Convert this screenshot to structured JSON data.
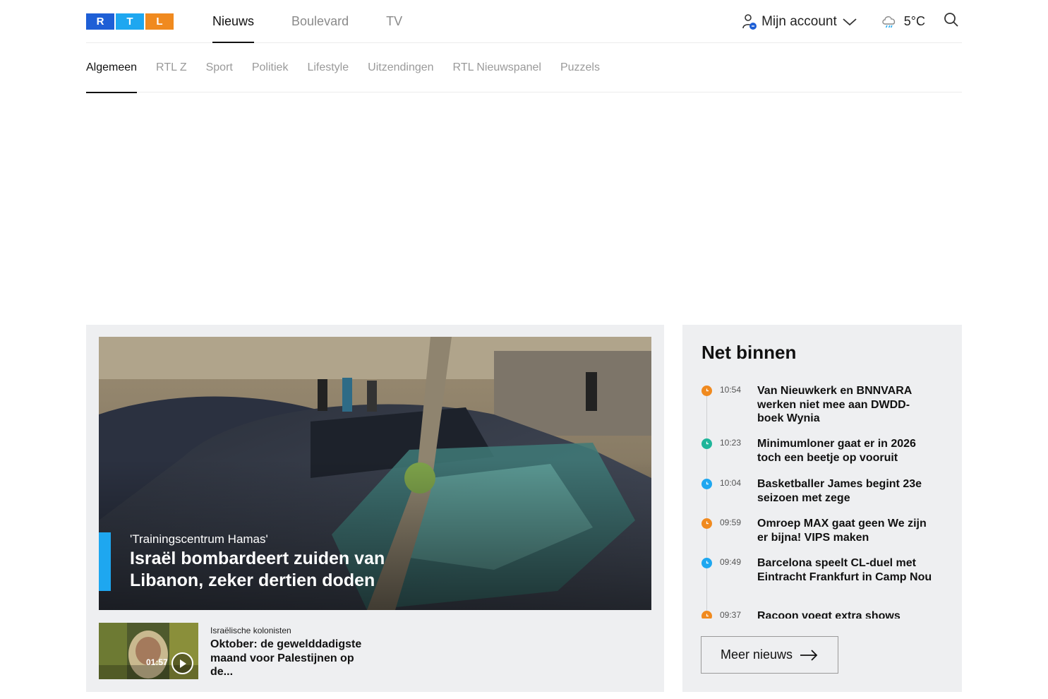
{
  "logo": {
    "letters": [
      "R",
      "T",
      "L"
    ],
    "colors": [
      "#1e5fd6",
      "#1ea7f0",
      "#f08a1f"
    ]
  },
  "main_nav": [
    {
      "label": "Nieuws",
      "active": true
    },
    {
      "label": "Boulevard",
      "active": false
    },
    {
      "label": "TV",
      "active": false
    }
  ],
  "account": {
    "label": "Mijn account",
    "icon": "user-icon"
  },
  "weather": {
    "temperature": "5°C",
    "icon": "rain-cloud-icon"
  },
  "search": {
    "icon": "search-icon"
  },
  "sub_nav": [
    {
      "label": "Algemeen",
      "active": true
    },
    {
      "label": "RTL Z",
      "active": false
    },
    {
      "label": "Sport",
      "active": false
    },
    {
      "label": "Politiek",
      "active": false
    },
    {
      "label": "Lifestyle",
      "active": false
    },
    {
      "label": "Uitzendingen",
      "active": false
    },
    {
      "label": "RTL Nieuwspanel",
      "active": false
    },
    {
      "label": "Puzzels",
      "active": false
    }
  ],
  "hero": {
    "kicker": "'Trainingscentrum Hamas'",
    "title": "Israël bombardeert zuiden van Libanon, zeker dertien doden",
    "accent_color": "#1ea7f0"
  },
  "sub_article": {
    "duration": "01:57",
    "kicker": "Israëlische kolonisten",
    "title": "Oktober: de gewelddadigste maand voor Palestijnen op de..."
  },
  "net_binnen": {
    "title": "Net binnen",
    "items": [
      {
        "time": "10:54",
        "title": "Van Nieuwkerk en BNNVARA werken niet mee aan DWDD-boek Wynia",
        "color": "#f08a1f"
      },
      {
        "time": "10:23",
        "title": "Minimumloner gaat er in 2026 toch een beetje op vooruit",
        "color": "#1fb59a"
      },
      {
        "time": "10:04",
        "title": "Basketballer James begint 23e seizoen met zege",
        "color": "#1ea7f0"
      },
      {
        "time": "09:59",
        "title": "Omroep MAX gaat geen We zijn er bijna! VIPS maken",
        "color": "#f08a1f"
      },
      {
        "time": "09:49",
        "title": "Barcelona speelt CL-duel met Eintracht Frankfurt in Camp Nou",
        "color": "#1ea7f0"
      },
      {
        "time": "09:37",
        "title": "Racoon voegt extra shows",
        "color": "#f08a1f"
      }
    ],
    "more_label": "Meer nieuws"
  }
}
